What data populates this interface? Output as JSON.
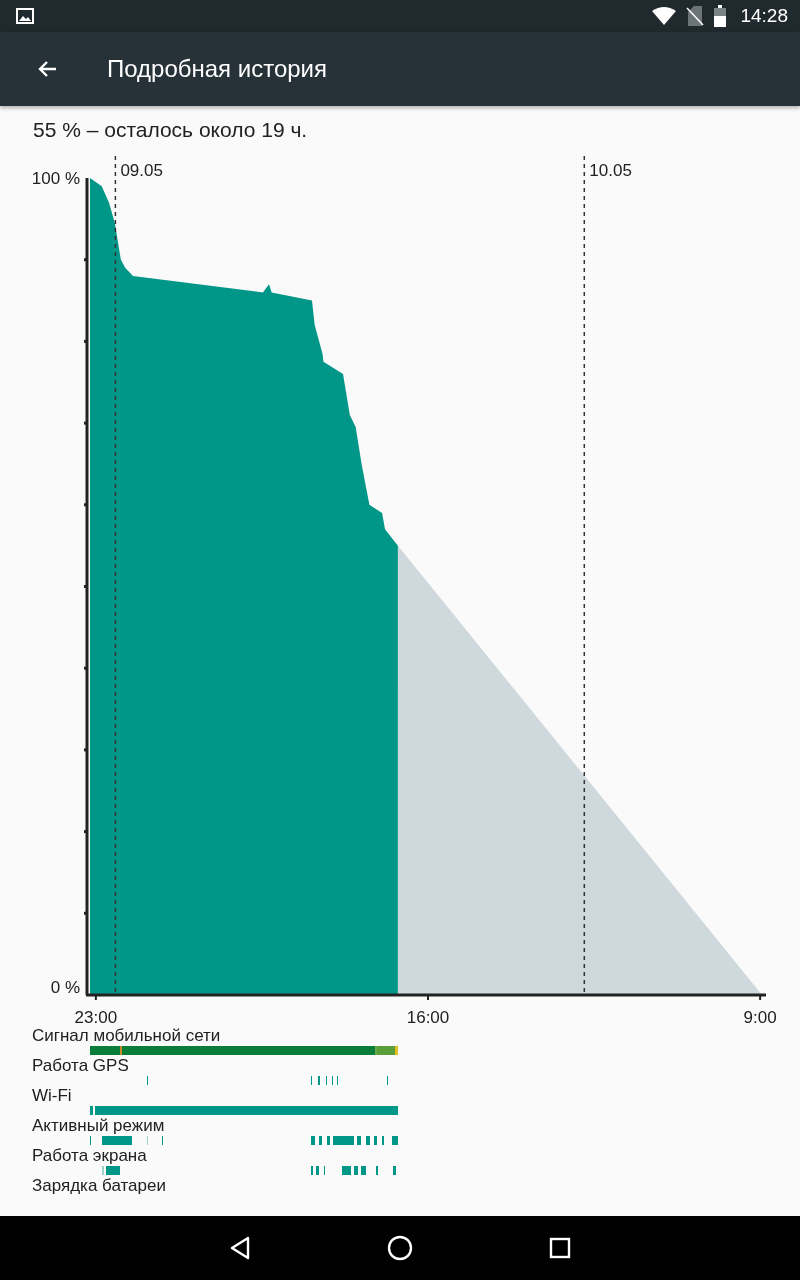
{
  "status_bar": {
    "time": "14:28"
  },
  "app_bar": {
    "title": "Подробная история"
  },
  "summary": "55 % – осталось около 19 ч.",
  "chart": {
    "y_labels": [
      "100 %",
      "0 %"
    ],
    "date_labels": [
      "09.05",
      "10.05"
    ],
    "time_labels": [
      "23:00",
      "16:00",
      "9:00"
    ]
  },
  "tracks": [
    {
      "label": "Сигнал мобильной сети",
      "kind": "signal"
    },
    {
      "label": "Работа GPS",
      "kind": "gps"
    },
    {
      "label": "Wi-Fi",
      "kind": "wifi"
    },
    {
      "label": "Активный режим",
      "kind": "awake"
    },
    {
      "label": "Работа экрана",
      "kind": "screen"
    },
    {
      "label": "Зарядка батареи",
      "kind": "charging"
    }
  ]
}
